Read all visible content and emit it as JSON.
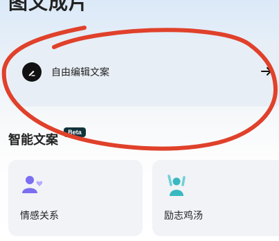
{
  "header": {
    "title": "图文成片"
  },
  "edit_card": {
    "label": "自由编辑文案",
    "icon": "pen-icon",
    "arrow_icon": "arrow-right-icon"
  },
  "section": {
    "title": "智能文案",
    "badge": "Beta"
  },
  "categories": [
    {
      "label": "情感关系",
      "icon": "people-heart-icon",
      "color": "#7b6ef0"
    },
    {
      "label": "励志鸡汤",
      "icon": "person-cheer-icon",
      "color": "#39b8c0"
    }
  ],
  "annotation": {
    "stroke_color": "#e0412b"
  }
}
